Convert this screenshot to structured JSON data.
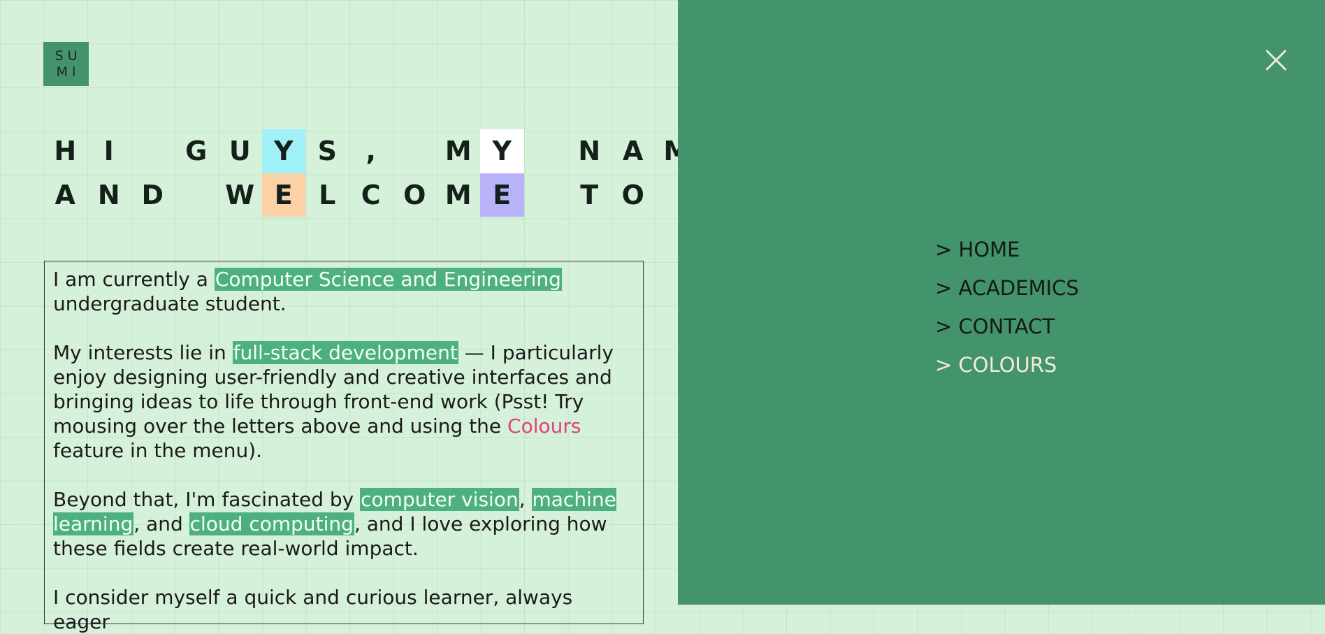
{
  "logo": {
    "line1": "SU",
    "line2": "MI"
  },
  "greeting": {
    "row1": [
      {
        "ch": "H",
        "bg": ""
      },
      {
        "ch": "I",
        "bg": ""
      },
      {
        "ch": "",
        "bg": ""
      },
      {
        "ch": "G",
        "bg": ""
      },
      {
        "ch": "U",
        "bg": ""
      },
      {
        "ch": "Y",
        "bg": "#9ff0f7"
      },
      {
        "ch": "S",
        "bg": ""
      },
      {
        "ch": ",",
        "bg": ""
      },
      {
        "ch": "",
        "bg": ""
      },
      {
        "ch": "M",
        "bg": ""
      },
      {
        "ch": "Y",
        "bg": "#ffffff"
      },
      {
        "ch": "",
        "bg": ""
      },
      {
        "ch": "N",
        "bg": ""
      },
      {
        "ch": "A",
        "bg": ""
      },
      {
        "ch": "M",
        "bg": ""
      }
    ],
    "row2": [
      {
        "ch": "A",
        "bg": ""
      },
      {
        "ch": "N",
        "bg": ""
      },
      {
        "ch": "D",
        "bg": ""
      },
      {
        "ch": "",
        "bg": ""
      },
      {
        "ch": "W",
        "bg": ""
      },
      {
        "ch": "E",
        "bg": "#fbd1a5"
      },
      {
        "ch": "L",
        "bg": ""
      },
      {
        "ch": "C",
        "bg": ""
      },
      {
        "ch": "O",
        "bg": ""
      },
      {
        "ch": "M",
        "bg": ""
      },
      {
        "ch": "E",
        "bg": "#b7b2fa"
      },
      {
        "ch": "",
        "bg": ""
      },
      {
        "ch": "T",
        "bg": ""
      },
      {
        "ch": "O",
        "bg": ""
      }
    ]
  },
  "about": {
    "p1_pre": "I am currently a ",
    "p1_hl": "Computer Science and Engineering",
    "p1_post": " undergraduate student.",
    "p2_pre": "My interests lie in ",
    "p2_hl": "full-stack development",
    "p2_mid": " — I particularly enjoy designing user-friendly and creative interfaces and bringing ideas to life through front-end work (Psst! Try mousing over the letters above and using the ",
    "p2_link": "Colours",
    "p2_post": " feature in the menu).",
    "p3_pre": "Beyond that, I'm fascinated by ",
    "p3_hl1": "computer vision",
    "p3_sep1": ", ",
    "p3_hl2": "machine learning",
    "p3_sep2": ", and ",
    "p3_hl3": "cloud computing",
    "p3_post": ", and I love exploring how these fields create real-world impact.",
    "p4": "I consider myself a quick and curious learner, always eager"
  },
  "menu": {
    "items": [
      {
        "label": "> HOME",
        "active": false
      },
      {
        "label": "> ACADEMICS",
        "active": false
      },
      {
        "label": "> CONTACT",
        "active": false
      },
      {
        "label": "> COLOURS",
        "active": true
      }
    ],
    "close_icon": "close-icon"
  },
  "colors": {
    "page_bg": "#d6f1da",
    "panel_bg": "#43936d",
    "highlight": "#4eb07f",
    "link_pink": "#e0427a",
    "active_item": "#f3ecd2"
  }
}
